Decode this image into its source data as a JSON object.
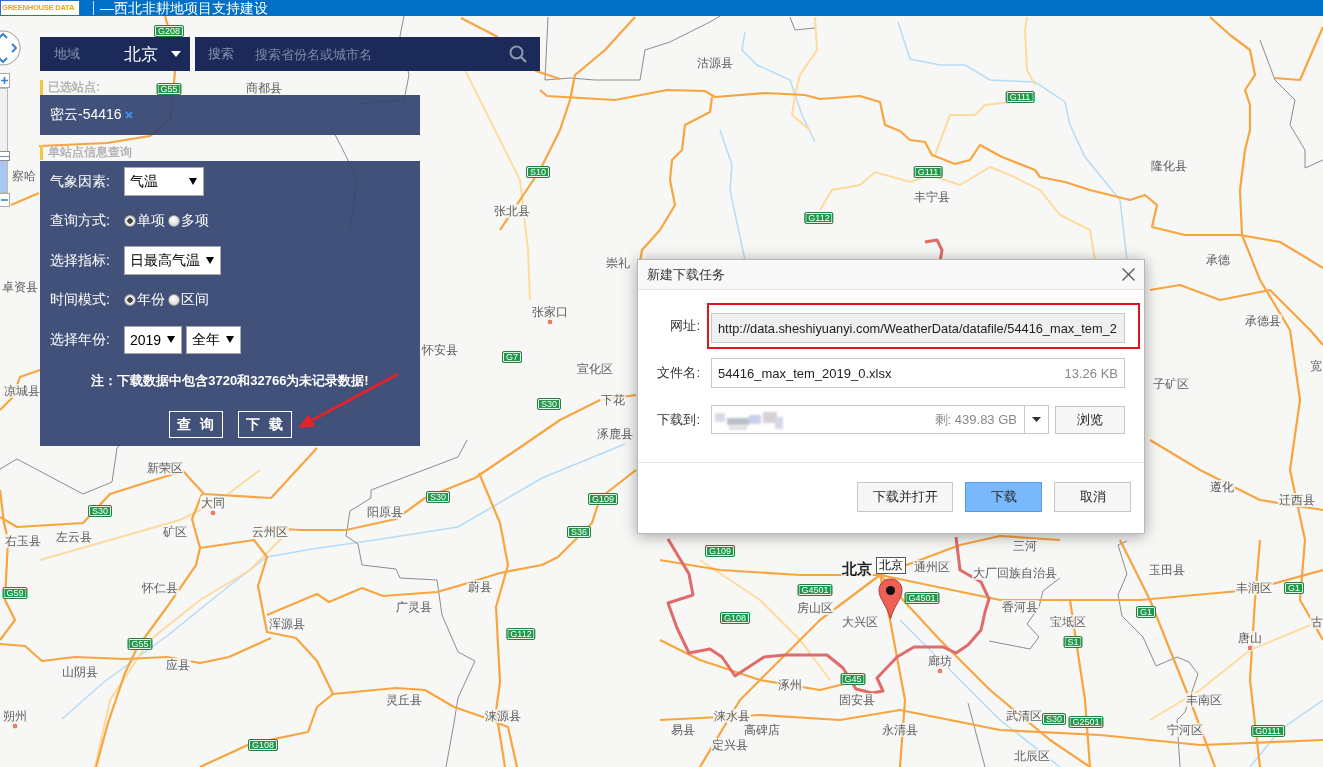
{
  "header": {
    "logo": "GREENHOUSE DATA",
    "title": "—西北非耕地项目支持建设"
  },
  "map_controls": {
    "zoom": {
      "level": 0.35
    }
  },
  "region_select": {
    "label": "地域",
    "value": "北京"
  },
  "search": {
    "label": "搜索",
    "placeholder": "搜索省份名或城市名"
  },
  "selected_stations": {
    "heading": "已选站点:",
    "items": [
      {
        "name": "密云-54416"
      }
    ]
  },
  "station_query": {
    "heading": "单站点信息查询",
    "rows": [
      {
        "kind": "select",
        "label": "气象因素:",
        "value": "气温"
      },
      {
        "kind": "radio",
        "label": "查询方式:",
        "options": [
          {
            "label": "单项",
            "selected": true
          },
          {
            "label": "多项",
            "selected": false
          }
        ]
      },
      {
        "kind": "select",
        "label": "选择指标:",
        "value": "日最高气温"
      },
      {
        "kind": "radio",
        "label": "时间模式:",
        "options": [
          {
            "label": "年份",
            "selected": true
          },
          {
            "label": "区间",
            "selected": false
          }
        ]
      },
      {
        "kind": "selects",
        "label": "选择年份:",
        "values": [
          "2019",
          "全年"
        ]
      }
    ],
    "note": "注：下载数据中包含3720和32766为未记录数据!",
    "buttons": [
      "查 询",
      "下 载"
    ]
  },
  "dialog": {
    "title": "新建下载任务",
    "fields": [
      {
        "kind": "url",
        "label": "网址:",
        "value": "http://data.sheshiyuanyi.com/WeatherData/datafile/54416_max_tem_2",
        "highlighted": true
      },
      {
        "kind": "file",
        "label": "文件名:",
        "value": "54416_max_tem_2019_0.xlsx",
        "size": "13.26 KB"
      },
      {
        "kind": "folder",
        "label": "下载到:",
        "free_space": "剩: 439.83 GB",
        "button": "浏览"
      }
    ],
    "buttons": [
      {
        "label": "下载并打开",
        "primary": false
      },
      {
        "label": "下载",
        "primary": true
      },
      {
        "label": "取消",
        "primary": false
      }
    ]
  },
  "map": {
    "places": [
      {
        "name": "沽源县",
        "kind": "town"
      },
      {
        "name": "商都县",
        "kind": "town"
      },
      {
        "name": "察哈",
        "kind": "town"
      },
      {
        "name": "隆化县",
        "kind": "town"
      },
      {
        "name": "丰宁县",
        "kind": "town"
      },
      {
        "name": "张北县",
        "kind": "town"
      },
      {
        "name": "崇礼",
        "kind": "town"
      },
      {
        "name": "承德",
        "kind": "town"
      },
      {
        "name": "卓资县",
        "kind": "town"
      },
      {
        "name": "张家口",
        "kind": "city"
      },
      {
        "name": "承德县",
        "kind": "town"
      },
      {
        "name": "怀安县",
        "kind": "town"
      },
      {
        "name": "宣化区",
        "kind": "town"
      },
      {
        "name": "宽",
        "kind": "town"
      },
      {
        "name": "凉城县",
        "kind": "town"
      },
      {
        "name": "子矿区",
        "kind": "town"
      },
      {
        "name": "下花",
        "kind": "town"
      },
      {
        "name": "涿鹿县",
        "kind": "town"
      },
      {
        "name": "新荣区",
        "kind": "town"
      },
      {
        "name": "遵化",
        "kind": "town"
      },
      {
        "name": "大同",
        "kind": "city"
      },
      {
        "name": "阳原县",
        "kind": "town"
      },
      {
        "name": "迁西县",
        "kind": "town"
      },
      {
        "name": "右玉县",
        "kind": "town"
      },
      {
        "name": "左云县",
        "kind": "town"
      },
      {
        "name": "矿区",
        "kind": "town"
      },
      {
        "name": "云州区",
        "kind": "town"
      },
      {
        "name": "三河",
        "kind": "town"
      },
      {
        "name": "北京",
        "kind": "capital"
      },
      {
        "name": "通州区",
        "kind": "town"
      },
      {
        "name": "大厂回族自治县",
        "kind": "town"
      },
      {
        "name": "玉田县",
        "kind": "town"
      },
      {
        "name": "怀仁县",
        "kind": "town"
      },
      {
        "name": "蔚县",
        "kind": "town"
      },
      {
        "name": "丰润区",
        "kind": "town"
      },
      {
        "name": "广灵县",
        "kind": "town"
      },
      {
        "name": "房山区",
        "kind": "town"
      },
      {
        "name": "香河县",
        "kind": "town"
      },
      {
        "name": "浑源县",
        "kind": "town"
      },
      {
        "name": "大兴区",
        "kind": "town"
      },
      {
        "name": "宝坻区",
        "kind": "town"
      },
      {
        "name": "古",
        "kind": "town"
      },
      {
        "name": "唐山",
        "kind": "city"
      },
      {
        "name": "山阴县",
        "kind": "town"
      },
      {
        "name": "应县",
        "kind": "town"
      },
      {
        "name": "廊坊",
        "kind": "city"
      },
      {
        "name": "涿州",
        "kind": "town"
      },
      {
        "name": "灵丘县",
        "kind": "town"
      },
      {
        "name": "固安县",
        "kind": "town"
      },
      {
        "name": "丰南区",
        "kind": "town"
      },
      {
        "name": "朔州",
        "kind": "city"
      },
      {
        "name": "涞源县",
        "kind": "town"
      },
      {
        "name": "涞水县",
        "kind": "town"
      },
      {
        "name": "武清区",
        "kind": "town"
      },
      {
        "name": "易县",
        "kind": "town"
      },
      {
        "name": "高碑店",
        "kind": "town"
      },
      {
        "name": "永清县",
        "kind": "town"
      },
      {
        "name": "宁河区",
        "kind": "town"
      },
      {
        "name": "定兴县",
        "kind": "town"
      },
      {
        "name": "北辰区",
        "kind": "town"
      }
    ],
    "road_signs": [
      "G208",
      "G55",
      "G111",
      "S10",
      "G111",
      "G112",
      "G7",
      "S30",
      "S30",
      "G109",
      "S30",
      "S36",
      "G109",
      "G59",
      "G4501",
      "G4501",
      "G1",
      "G108",
      "G1",
      "G55",
      "G112",
      "S1",
      "G45",
      "S30",
      "G2501",
      "G0111",
      "G108"
    ],
    "marker": {
      "label": "北京"
    }
  }
}
